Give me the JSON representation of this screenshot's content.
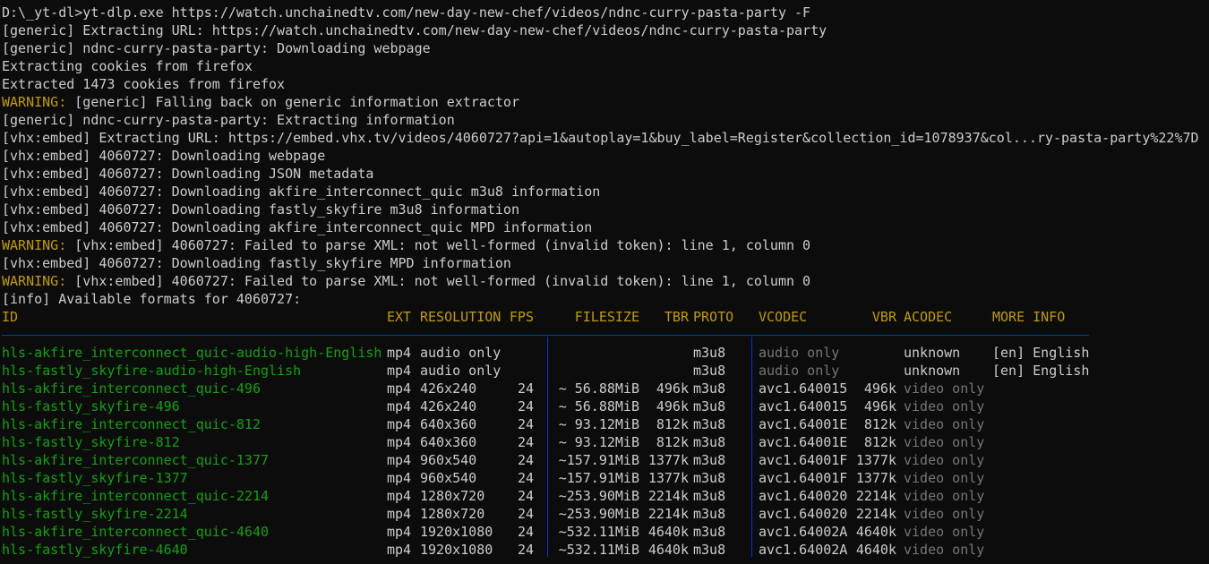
{
  "command": "D:\\_yt-dl>yt-dlp.exe https://watch.unchainedtv.com/new-day-new-chef/videos/ndnc-curry-pasta-party -F",
  "log": [
    {
      "prefix": "",
      "text": "[generic] Extracting URL: https://watch.unchainedtv.com/new-day-new-chef/videos/ndnc-curry-pasta-party"
    },
    {
      "prefix": "",
      "text": "[generic] ndnc-curry-pasta-party: Downloading webpage"
    },
    {
      "prefix": "",
      "text": "Extracting cookies from firefox"
    },
    {
      "prefix": "",
      "text": "Extracted 1473 cookies from firefox"
    },
    {
      "prefix": "WARNING:",
      "text": " [generic] Falling back on generic information extractor"
    },
    {
      "prefix": "",
      "text": "[generic] ndnc-curry-pasta-party: Extracting information"
    },
    {
      "prefix": "",
      "text": "[vhx:embed] Extracting URL: https://embed.vhx.tv/videos/4060727?api=1&autoplay=1&buy_label=Register&collection_id=1078937&col...ry-pasta-party%22%7D"
    },
    {
      "prefix": "",
      "text": "[vhx:embed] 4060727: Downloading webpage"
    },
    {
      "prefix": "",
      "text": "[vhx:embed] 4060727: Downloading JSON metadata"
    },
    {
      "prefix": "",
      "text": "[vhx:embed] 4060727: Downloading akfire_interconnect_quic m3u8 information"
    },
    {
      "prefix": "",
      "text": "[vhx:embed] 4060727: Downloading fastly_skyfire m3u8 information"
    },
    {
      "prefix": "",
      "text": "[vhx:embed] 4060727: Downloading akfire_interconnect_quic MPD information"
    },
    {
      "prefix": "WARNING:",
      "text": " [vhx:embed] 4060727: Failed to parse XML: not well-formed (invalid token): line 1, column 0"
    },
    {
      "prefix": "",
      "text": "[vhx:embed] 4060727: Downloading fastly_skyfire MPD information"
    },
    {
      "prefix": "WARNING:",
      "text": " [vhx:embed] 4060727: Failed to parse XML: not well-formed (invalid token): line 1, column 0"
    },
    {
      "prefix": "",
      "text": "[info] Available formats for 4060727:"
    }
  ],
  "table": {
    "headers": {
      "id": "ID",
      "ext": "EXT",
      "resolution": "RESOLUTION",
      "fps": "FPS",
      "filesize": "FILESIZE",
      "tbr": "TBR",
      "proto": "PROTO",
      "vcodec": "VCODEC",
      "vbr": "VBR",
      "acodec": "ACODEC",
      "more_info": "MORE INFO"
    },
    "rows": [
      {
        "id": "hls-akfire_interconnect_quic-audio-high-English",
        "ext": "mp4",
        "resolution": "audio only",
        "fps": "",
        "filesize": "",
        "tbr": "",
        "proto": "m3u8",
        "vcodec": "audio only",
        "vbr": "",
        "acodec": "unknown",
        "more_info": "[en] English"
      },
      {
        "id": "hls-fastly_skyfire-audio-high-English",
        "ext": "mp4",
        "resolution": "audio only",
        "fps": "",
        "filesize": "",
        "tbr": "",
        "proto": "m3u8",
        "vcodec": "audio only",
        "vbr": "",
        "acodec": "unknown",
        "more_info": "[en] English"
      },
      {
        "id": "hls-akfire_interconnect_quic-496",
        "ext": "mp4",
        "resolution": "426x240",
        "fps": "24",
        "filesize": "~ 56.88MiB",
        "tbr": "496k",
        "proto": "m3u8",
        "vcodec": "avc1.640015",
        "vbr": "496k",
        "acodec": "video only",
        "more_info": ""
      },
      {
        "id": "hls-fastly_skyfire-496",
        "ext": "mp4",
        "resolution": "426x240",
        "fps": "24",
        "filesize": "~ 56.88MiB",
        "tbr": "496k",
        "proto": "m3u8",
        "vcodec": "avc1.640015",
        "vbr": "496k",
        "acodec": "video only",
        "more_info": ""
      },
      {
        "id": "hls-akfire_interconnect_quic-812",
        "ext": "mp4",
        "resolution": "640x360",
        "fps": "24",
        "filesize": "~ 93.12MiB",
        "tbr": "812k",
        "proto": "m3u8",
        "vcodec": "avc1.64001E",
        "vbr": "812k",
        "acodec": "video only",
        "more_info": ""
      },
      {
        "id": "hls-fastly_skyfire-812",
        "ext": "mp4",
        "resolution": "640x360",
        "fps": "24",
        "filesize": "~ 93.12MiB",
        "tbr": "812k",
        "proto": "m3u8",
        "vcodec": "avc1.64001E",
        "vbr": "812k",
        "acodec": "video only",
        "more_info": ""
      },
      {
        "id": "hls-akfire_interconnect_quic-1377",
        "ext": "mp4",
        "resolution": "960x540",
        "fps": "24",
        "filesize": "~157.91MiB",
        "tbr": "1377k",
        "proto": "m3u8",
        "vcodec": "avc1.64001F",
        "vbr": "1377k",
        "acodec": "video only",
        "more_info": ""
      },
      {
        "id": "hls-fastly_skyfire-1377",
        "ext": "mp4",
        "resolution": "960x540",
        "fps": "24",
        "filesize": "~157.91MiB",
        "tbr": "1377k",
        "proto": "m3u8",
        "vcodec": "avc1.64001F",
        "vbr": "1377k",
        "acodec": "video only",
        "more_info": ""
      },
      {
        "id": "hls-akfire_interconnect_quic-2214",
        "ext": "mp4",
        "resolution": "1280x720",
        "fps": "24",
        "filesize": "~253.90MiB",
        "tbr": "2214k",
        "proto": "m3u8",
        "vcodec": "avc1.640020",
        "vbr": "2214k",
        "acodec": "video only",
        "more_info": ""
      },
      {
        "id": "hls-fastly_skyfire-2214",
        "ext": "mp4",
        "resolution": "1280x720",
        "fps": "24",
        "filesize": "~253.90MiB",
        "tbr": "2214k",
        "proto": "m3u8",
        "vcodec": "avc1.640020",
        "vbr": "2214k",
        "acodec": "video only",
        "more_info": ""
      },
      {
        "id": "hls-akfire_interconnect_quic-4640",
        "ext": "mp4",
        "resolution": "1920x1080",
        "fps": "24",
        "filesize": "~532.11MiB",
        "tbr": "4640k",
        "proto": "m3u8",
        "vcodec": "avc1.64002A",
        "vbr": "4640k",
        "acodec": "video only",
        "more_info": ""
      },
      {
        "id": "hls-fastly_skyfire-4640",
        "ext": "mp4",
        "resolution": "1920x1080",
        "fps": "24",
        "filesize": "~532.11MiB",
        "tbr": "4640k",
        "proto": "m3u8",
        "vcodec": "avc1.64002A",
        "vbr": "4640k",
        "acodec": "video only",
        "more_info": ""
      }
    ]
  },
  "colors": {
    "background": "#0c0c0c",
    "text": "#cccccc",
    "warning": "#c19c00",
    "format_id": "#13a10e",
    "dim": "#767676",
    "separator": "#0037da"
  }
}
